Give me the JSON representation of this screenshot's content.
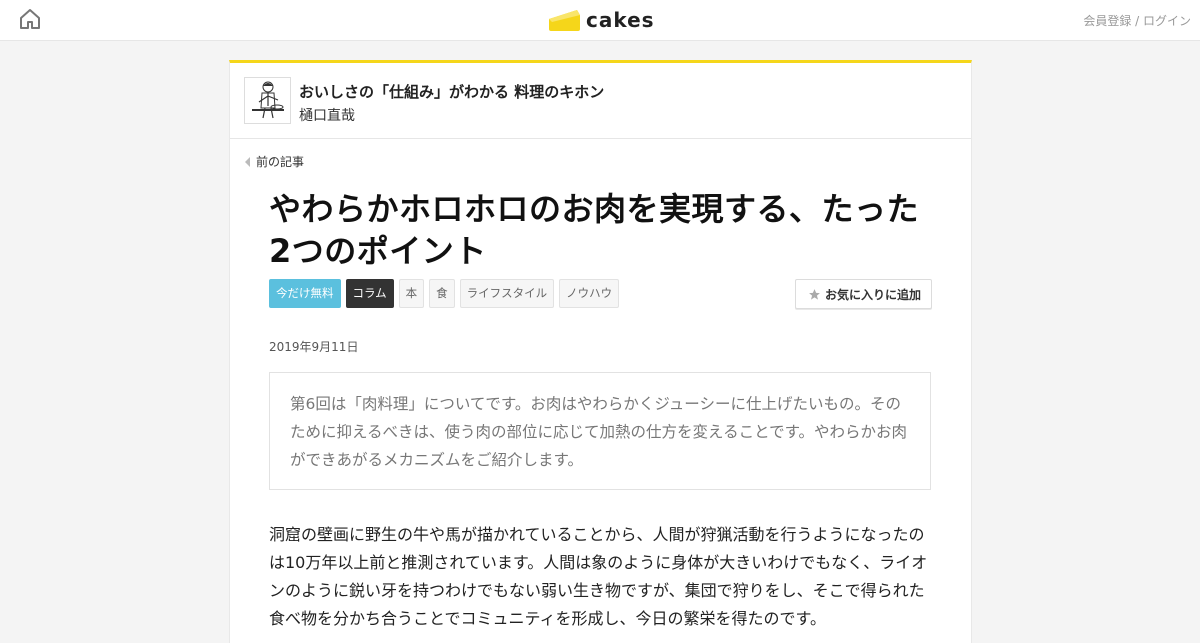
{
  "header": {
    "logo_text": "cakes",
    "auth_link": "会員登録 / ログイン",
    "brand_color": "#f5d61a"
  },
  "series": {
    "title": "おいしさの「仕組み」がわかる 料理のキホン",
    "author": "樋口直哉"
  },
  "nav": {
    "prev_label": "前の記事"
  },
  "article": {
    "title": "やわらかホロホロのお肉を実現する、たった2つのポイント",
    "tags": [
      "今だけ無料",
      "コラム",
      "本",
      "食",
      "ライフスタイル",
      "ノウハウ"
    ],
    "favorite_label": "お気に入りに追加",
    "date": "2019年9月11日",
    "lead": "第6回は「肉料理」についてです。お肉はやわらかくジューシーに仕上げたいもの。そのために抑えるべきは、使う肉の部位に応じて加熱の仕方を変えることです。やわらかお肉ができあがるメカニズムをご紹介します。",
    "body": "洞窟の壁画に野生の牛や馬が描かれていることから、人間が狩猟活動を行うようになったのは10万年以上前と推測されています。人間は象のように身体が大きいわけでもなく、ライオンのように鋭い牙を持つわけでもない弱い生き物ですが、集団で狩りをし、そこで得られた食べ物を分かち合うことでコミュニティを形成し、今日の繁栄を得たのです。"
  }
}
